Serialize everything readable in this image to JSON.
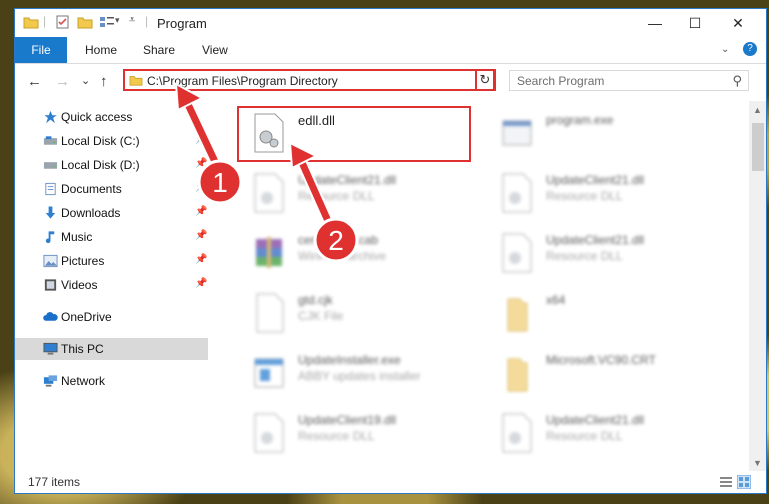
{
  "window": {
    "title": "Program",
    "controls": {
      "minimize": "—",
      "maximize": "☐",
      "close": "✕"
    }
  },
  "ribbon": {
    "tabs": [
      {
        "label": "File"
      },
      {
        "label": "Home"
      },
      {
        "label": "Share"
      },
      {
        "label": "View"
      }
    ],
    "help_icon": "?"
  },
  "address_bar": {
    "path": "C:\\Program Files\\Program Directory",
    "dropdown": "⌄",
    "refresh": "↻"
  },
  "search": {
    "placeholder": "Search Program",
    "icon": "⚲"
  },
  "nav": {
    "back": "←",
    "forward": "→",
    "recent": "⌄",
    "up": "↑"
  },
  "sidebar": {
    "items": [
      {
        "label": "Quick access",
        "icon": "star-icon",
        "pinned": false
      },
      {
        "label": "Local Disk (C:)",
        "icon": "drive-icon",
        "pinned": true
      },
      {
        "label": "Local Disk (D:)",
        "icon": "drive-icon",
        "pinned": true
      },
      {
        "label": "Documents",
        "icon": "documents-icon",
        "pinned": true
      },
      {
        "label": "Downloads",
        "icon": "download-icon",
        "pinned": true
      },
      {
        "label": "Music",
        "icon": "music-icon",
        "pinned": true
      },
      {
        "label": "Pictures",
        "icon": "pictures-icon",
        "pinned": true
      },
      {
        "label": "Videos",
        "icon": "videos-icon",
        "pinned": true
      },
      {
        "label": "OneDrive",
        "icon": "cloud-icon",
        "pinned": false
      },
      {
        "label": "This PC",
        "icon": "computer-icon",
        "pinned": false,
        "selected": true
      },
      {
        "label": "Network",
        "icon": "network-icon",
        "pinned": false
      }
    ]
  },
  "files": [
    {
      "name": "edll.dll",
      "type": "",
      "icon": "dll-file-icon",
      "highlighted": true
    },
    {
      "name": "program.exe",
      "type": "",
      "icon": "exe-file-icon"
    },
    {
      "name": "UpdateClient21.dll",
      "type": "Resource DLL",
      "icon": "dll-file-icon"
    },
    {
      "name": "UpdateClient21.dll",
      "type": "Resource DLL",
      "icon": "dll-file-icon"
    },
    {
      "name": "certificates.cab",
      "type": "WinRAR archive",
      "icon": "archive-icon"
    },
    {
      "name": "UpdateClient21.dll",
      "type": "Resource DLL",
      "icon": "dll-file-icon"
    },
    {
      "name": "gtd.cjk",
      "type": "CJK File",
      "icon": "file-icon"
    },
    {
      "name": "x64",
      "type": "",
      "icon": "folder-icon"
    },
    {
      "name": "UpdateInstaller.exe",
      "type": "ABBY updates installer",
      "icon": "installer-icon"
    },
    {
      "name": "Microsoft.VC90.CRT",
      "type": "",
      "icon": "folder-icon"
    },
    {
      "name": "UpdateClient19.dll",
      "type": "Resource DLL",
      "icon": "dll-file-icon"
    },
    {
      "name": "UpdateClient21.dll",
      "type": "Resource DLL",
      "icon": "dll-file-icon"
    }
  ],
  "status": {
    "item_count": "177 items"
  },
  "annotations": [
    {
      "number": "1"
    },
    {
      "number": "2"
    }
  ],
  "colors": {
    "accent": "#1979ca",
    "annotation": "#e03131"
  }
}
